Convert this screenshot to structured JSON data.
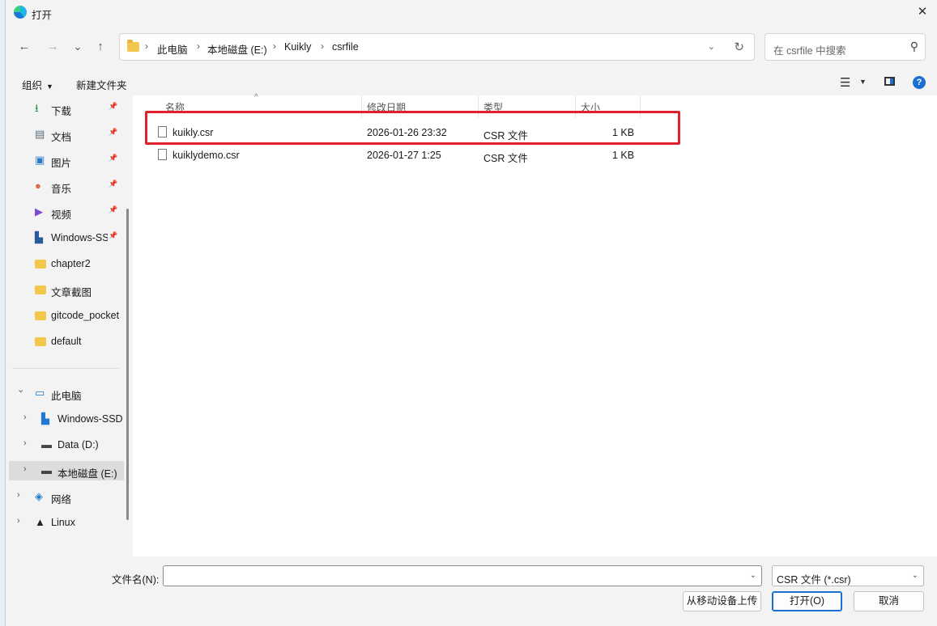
{
  "window": {
    "title": "打开"
  },
  "nav": {
    "back": "←",
    "forward": "→",
    "history": "⌄",
    "up": "↑",
    "breadcrumb": [
      "此电脑",
      "本地磁盘 (E:)",
      "Kuikly",
      "csrfile"
    ],
    "search_placeholder": "在 csrfile 中搜索"
  },
  "toolbar": {
    "organize": "组织",
    "new_folder": "新建文件夹",
    "help": "?"
  },
  "sidebar": {
    "quick": [
      {
        "label": "下载",
        "icon": "download-icon",
        "color": "#2a8a3a"
      },
      {
        "label": "文档",
        "icon": "document-icon",
        "color": "#5b6b7b"
      },
      {
        "label": "图片",
        "icon": "picture-icon",
        "color": "#2a78c8"
      },
      {
        "label": "音乐",
        "icon": "music-icon",
        "color": "#e06a4a"
      },
      {
        "label": "视频",
        "icon": "video-icon",
        "color": "#7a4ad0"
      },
      {
        "label": "Windows-SSD",
        "icon": "drive-icon",
        "color": "#2a5a9a"
      },
      {
        "label": "chapter2",
        "icon": "folder-icon",
        "color": "#f3c64e"
      },
      {
        "label": "文章截图",
        "icon": "folder-icon",
        "color": "#f3c64e"
      },
      {
        "label": "gitcode_pocket",
        "icon": "folder-icon",
        "color": "#f3c64e"
      },
      {
        "label": "default",
        "icon": "folder-icon",
        "color": "#f3c64e"
      }
    ],
    "tree": [
      {
        "label": "此电脑",
        "icon": "computer-icon",
        "expanded": true,
        "indent": 0
      },
      {
        "label": "Windows-SSD",
        "icon": "drive-icon",
        "indent": 1
      },
      {
        "label": "Data (D:)",
        "icon": "disk-icon",
        "indent": 1
      },
      {
        "label": "本地磁盘 (E:)",
        "icon": "disk-icon",
        "indent": 1,
        "selected": true
      },
      {
        "label": "网络",
        "icon": "network-icon",
        "indent": 0
      },
      {
        "label": "Linux",
        "icon": "linux-icon",
        "indent": 0
      }
    ]
  },
  "columns": [
    "名称",
    "修改日期",
    "类型",
    "大小"
  ],
  "files": [
    {
      "name": "kuikly.csr",
      "date": "2026-01-26 23:32",
      "type": "CSR 文件",
      "size": "1 KB"
    },
    {
      "name": "kuiklydemo.csr",
      "date": "2026-01-27 1:25",
      "type": "CSR 文件",
      "size": "1 KB"
    }
  ],
  "bottom": {
    "filename_label": "文件名(N):",
    "filename_value": "",
    "filetype": "CSR 文件 (*.csr)",
    "upload_button": "从移动设备上传",
    "open_button": "打开(O)",
    "cancel_button": "取消"
  }
}
